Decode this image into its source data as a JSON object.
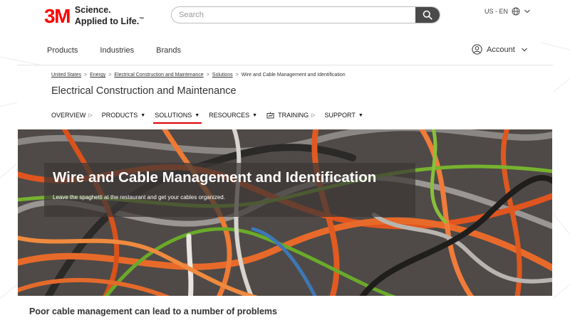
{
  "brand": {
    "logo_text": "3M",
    "tagline_line1": "Science.",
    "tagline_line2": "Applied to Life.",
    "trademark": "™"
  },
  "search": {
    "placeholder": "Search",
    "button_icon": "search-icon"
  },
  "locale": {
    "label": "US - EN",
    "globe_icon": "globe-icon",
    "chevron_icon": "chevron-down-icon"
  },
  "main_nav": {
    "items": [
      "Products",
      "Industries",
      "Brands"
    ],
    "account_label": "Account",
    "account_icon": "user-circle-icon"
  },
  "breadcrumb": {
    "items": [
      "United States",
      "Energy",
      "Electrical Construction and Maintenance",
      "Solutions"
    ],
    "current": "Wire and Cable Management and Identification",
    "separator": ">"
  },
  "page_title": "Electrical Construction and Maintenance",
  "subnav": {
    "items": [
      {
        "label": "OVERVIEW",
        "arrow": "▷"
      },
      {
        "label": "PRODUCTS",
        "arrow": "▼"
      },
      {
        "label": "SOLUTIONS",
        "arrow": "▼",
        "active": true
      },
      {
        "label": "RESOURCES",
        "arrow": "▼"
      },
      {
        "label": "TRAINING",
        "arrow": "▷",
        "icon": "training-icon"
      },
      {
        "label": "SUPPORT",
        "arrow": "▼"
      }
    ],
    "active_color": "#dd0000"
  },
  "hero": {
    "title": "Wire and Cable Management and Identification",
    "subtitle": "Leave the spaghetti at the restaurant and get your cables organized."
  },
  "section_heading": "Poor cable management can lead to a number of problems",
  "colors": {
    "brand_red": "#ff0000",
    "text": "#333333",
    "search_button": "#4a4a4a"
  }
}
